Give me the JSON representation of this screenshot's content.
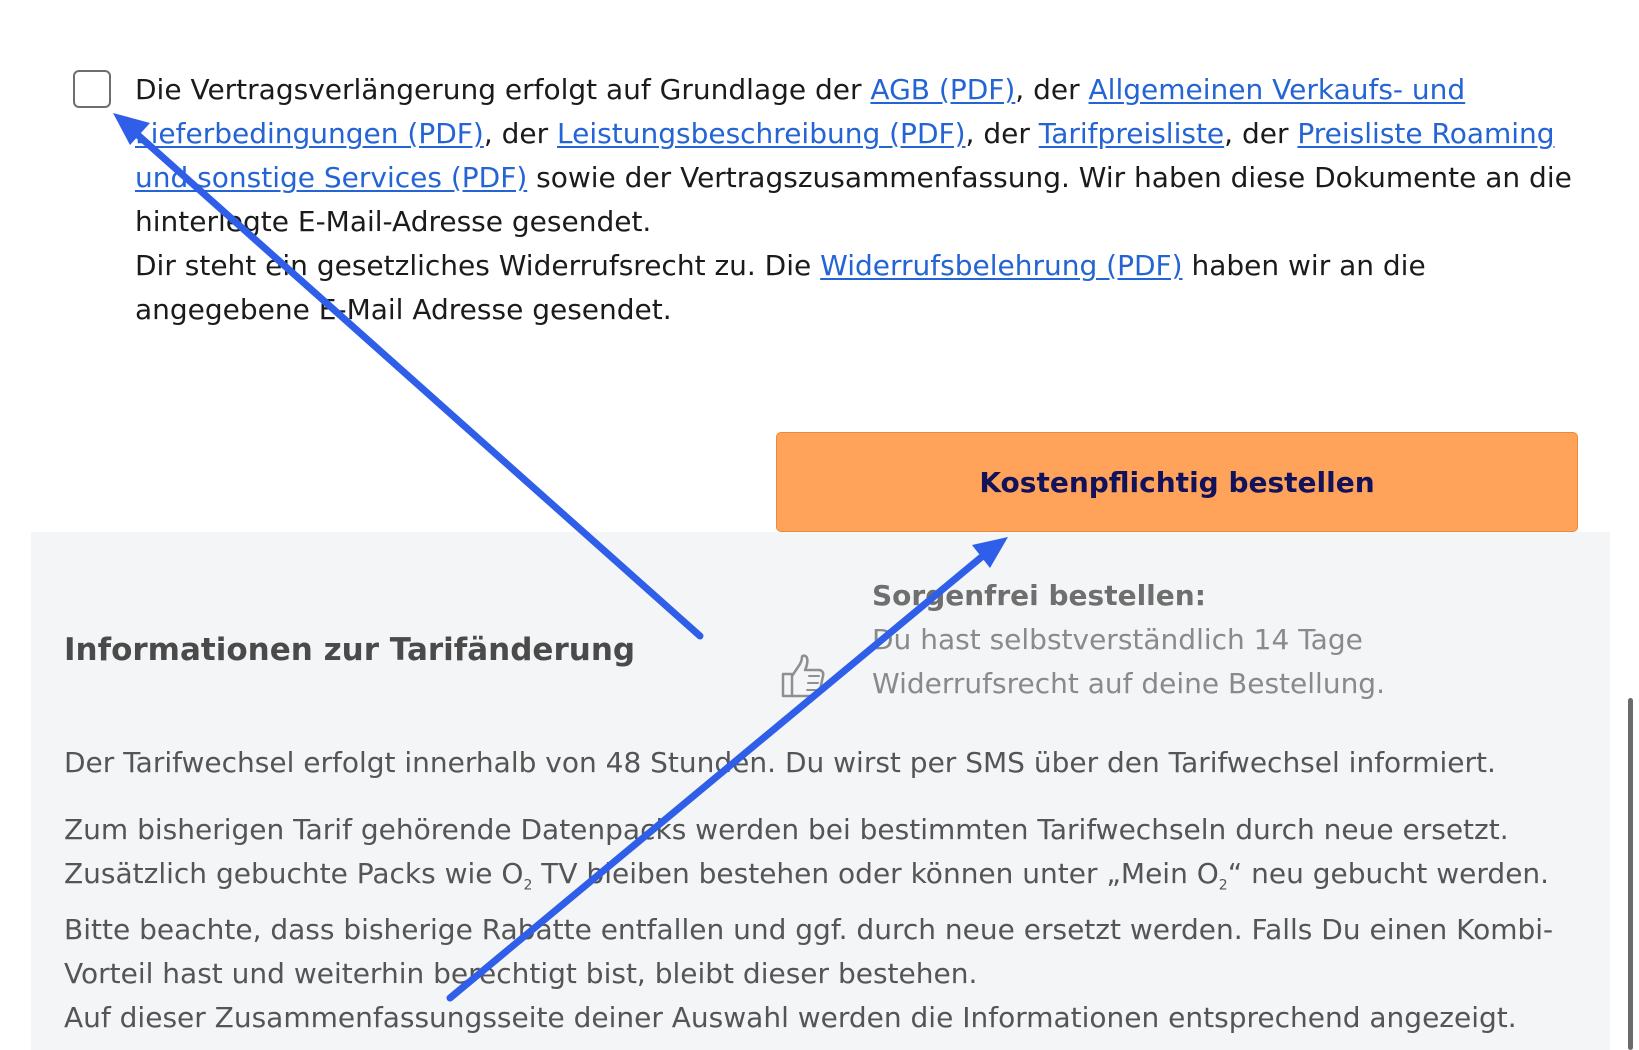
{
  "consent": {
    "text_intro": "Die Vertragsverlängerung erfolgt auf Grundlage der ",
    "link_agb": "AGB (PDF)",
    "sep_1": ", der ",
    "link_verkaufsbedingungen": "Allgemeinen Verkaufs- und Lieferbedingungen (PDF)",
    "sep_2": ", der ",
    "link_leistungsbeschreibung": "Leistungsbeschreibung (PDF)",
    "sep_3": ", der ",
    "link_tarifpreisliste": "Tarifpreisliste",
    "sep_4": ", der ",
    "link_roaming": "Preisliste Roaming und sonstige Services (PDF)",
    "text_after_links": " sowie der Vertragszusammenfassung. Wir haben diese Dokumente an die hinterlegte E-Mail-Adresse gesendet.",
    "text_widerruf_pre": "Dir steht ein gesetzliches Widerrufsrecht zu. Die ",
    "link_widerrufsbelehrung": "Widerrufsbelehrung (PDF)",
    "text_widerruf_post": " haben wir an die angegebene E-Mail Adresse gesendet."
  },
  "order_button": {
    "label": "Kostenpflichtig bestellen"
  },
  "sorgenfrei": {
    "title": "Sorgenfrei bestellen:",
    "text": "Du hast selbstverständlich 14 Tage Widerrufsrecht auf deine Bestellung.",
    "icon": "thumbs-up-icon"
  },
  "info": {
    "title": "Informationen zur Tarifänderung",
    "paragraph_1": "Der Tarifwechsel erfolgt innerhalb von 48 Stunden. Du wirst per SMS über den Tarifwechsel informiert.",
    "paragraph_2a": "Zum bisherigen Tarif gehörende Datenpacks werden bei bestimmten Tarifwechseln durch neue ersetzt. Zusätzlich gebuchte Packs wie O",
    "o2_sub": "2",
    "paragraph_2b": " TV bleiben bestehen oder können unter „Mein O",
    "paragraph_2c": "“ neu gebucht werden. Bitte beachte, dass bisherige Rabatte entfallen und ggf. durch neue ersetzt werden. Falls Du einen Kombi-Vorteil hast und weiterhin berechtigt bist, bleibt dieser bestehen.",
    "paragraph_3": "Auf dieser Zusammenfassungsseite deiner Auswahl werden die Informationen entsprechend angezeigt."
  },
  "colors": {
    "link": "#2464d4",
    "button_bg": "#ffa25a",
    "button_text": "#12125a",
    "panel_bg": "#f4f5f7",
    "annotation_arrow": "#2f5ee8"
  }
}
